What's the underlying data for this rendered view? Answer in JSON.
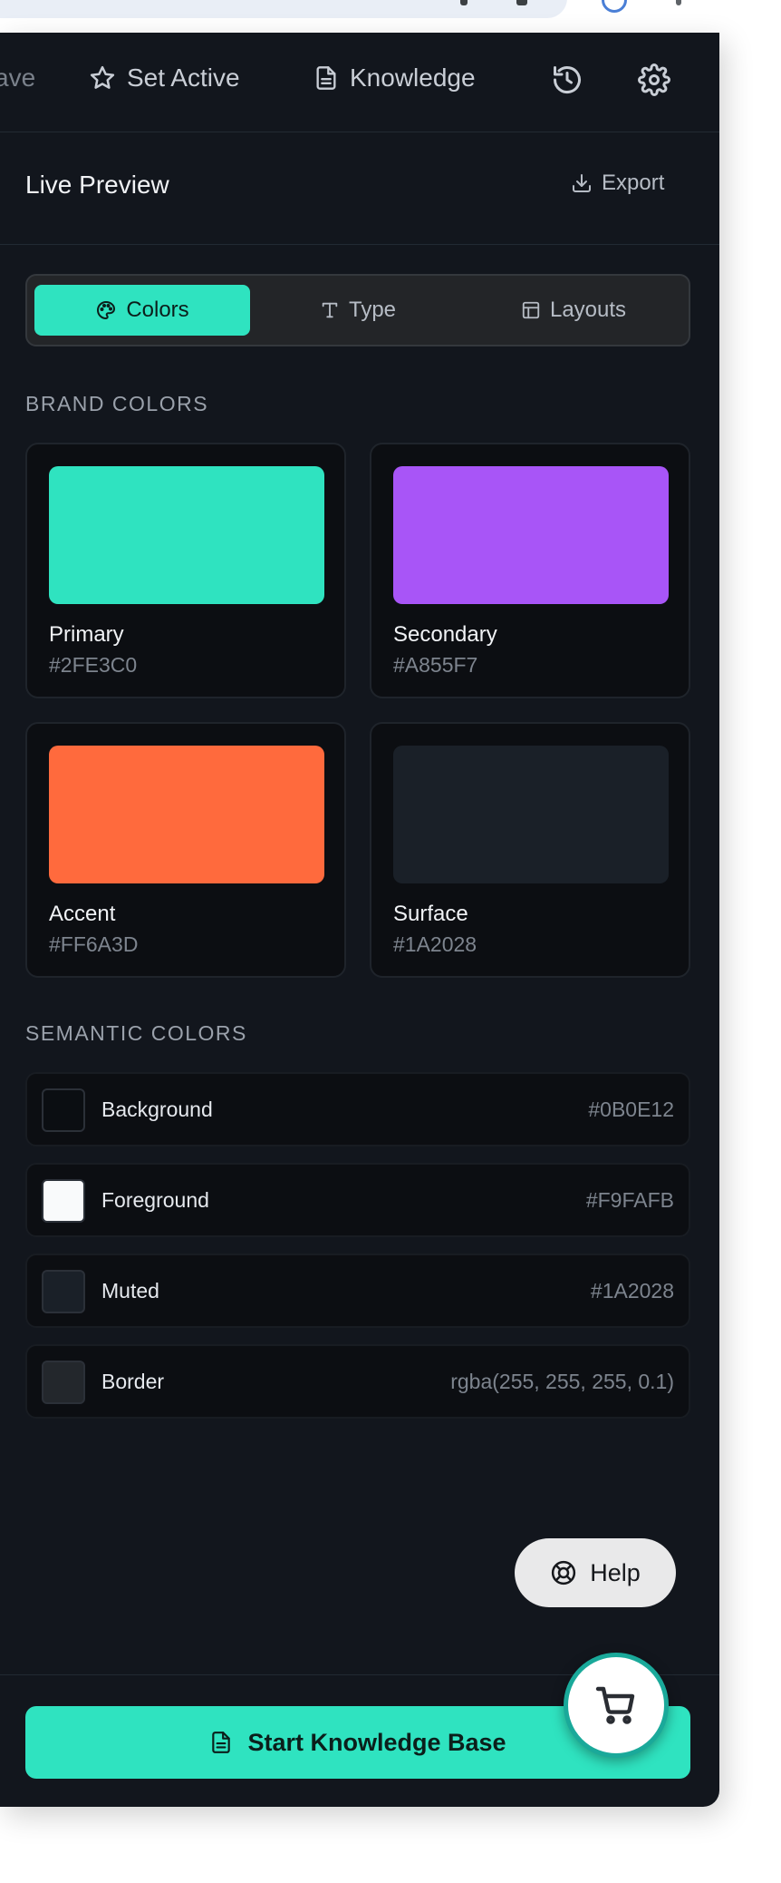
{
  "toolbar": {
    "cut_label": "ave",
    "set_active_label": "Set Active",
    "knowledge_label": "Knowledge",
    "history_icon": "history-icon",
    "settings_icon": "gear-icon"
  },
  "preview": {
    "title": "Live Preview",
    "export_label": "Export"
  },
  "tabs": [
    {
      "label": "Colors",
      "icon": "palette-icon",
      "active": true
    },
    {
      "label": "Type",
      "icon": "type-icon",
      "active": false
    },
    {
      "label": "Layouts",
      "icon": "layout-icon",
      "active": false
    }
  ],
  "brand": {
    "heading": "BRAND COLORS",
    "colors": [
      {
        "name": "Primary",
        "hex": "#2FE3C0",
        "swatch": "#2fe3c0"
      },
      {
        "name": "Secondary",
        "hex": "#A855F7",
        "swatch": "#a855f7"
      },
      {
        "name": "Accent",
        "hex": "#FF6A3D",
        "swatch": "#ff6a3d"
      },
      {
        "name": "Surface",
        "hex": "#1A2028",
        "swatch": "#1a2028"
      }
    ]
  },
  "semantic": {
    "heading": "SEMANTIC COLORS",
    "colors": [
      {
        "name": "Background",
        "value": "#0B0E12",
        "swatch": "#0b0e12"
      },
      {
        "name": "Foreground",
        "value": "#F9FAFB",
        "swatch": "#f9fafb"
      },
      {
        "name": "Muted",
        "value": "#1A2028",
        "swatch": "#1a2028"
      },
      {
        "name": "Border",
        "value": "rgba(255, 255, 255, 0.1)",
        "swatch": "#23272c"
      }
    ]
  },
  "help": {
    "label": "Help",
    "icon": "lifebuoy-icon"
  },
  "cta": {
    "label": "Start Knowledge Base",
    "icon": "document-icon"
  },
  "cart": {
    "icon": "cart-icon"
  },
  "colors": {
    "panel_bg": "#12161d",
    "accent": "#2fe3c0"
  }
}
